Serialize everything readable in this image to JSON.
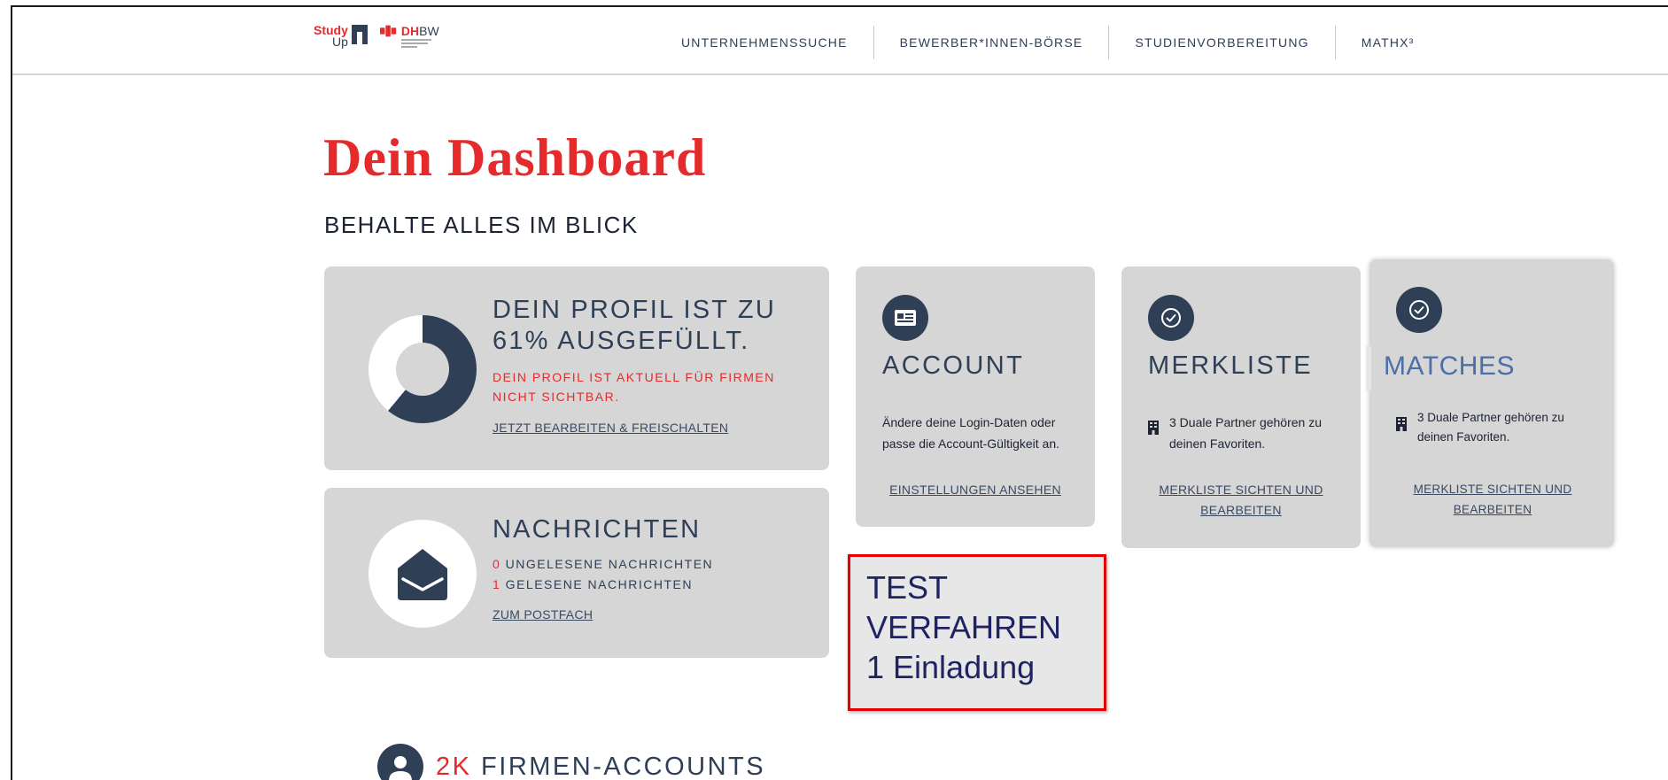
{
  "colors": {
    "accent_red": "#e42a2a",
    "navy": "#2e3f56",
    "card_bg": "#d6d6d6",
    "test_border": "#e40000",
    "test_text": "#1f2363",
    "match_title": "#4b6fa6"
  },
  "logo": {
    "study": "Study",
    "up": "Up",
    "dh": "DH",
    "bw": "BW"
  },
  "nav": [
    "UNTERNEHMENSSUCHE",
    "BEWERBER*INNEN-BÖRSE",
    "STUDIENVORBEREITUNG",
    "MATHX³"
  ],
  "page": {
    "title": "Dein Dashboard",
    "subtitle": "BEHALTE ALLES IM BLICK"
  },
  "profile": {
    "title_line1": "DEIN PROFIL IST ZU",
    "title_line2": "61% AUSGEFÜLLT.",
    "percent": 61,
    "status_line1": "DEIN PROFIL IST AKTUELL FÜR FIRMEN",
    "status_line2": "NICHT SICHTBAR.",
    "link": "JETZT BEARBEITEN & FREISCHALTEN"
  },
  "messages": {
    "title": "NACHRICHTEN",
    "unread_count": "0",
    "unread_label": " UNGELESENE NACHRICHTEN",
    "read_count": "1",
    "read_label": " GELESENE NACHRICHTEN",
    "link": "ZUM POSTFACH"
  },
  "account": {
    "icon": "id-card-icon",
    "title": "ACCOUNT",
    "body_line1": "Ändere deine Login-Daten oder",
    "body_line2": "passe die Account-Gültigkeit an.",
    "link": "EINSTELLUNGEN ANSEHEN"
  },
  "merkliste": {
    "icon": "check-circle-icon",
    "title": "MERKLISTE",
    "body_line1": "3 Duale Partner gehören zu",
    "body_line2": "deinen Favoriten.",
    "link_line1": "MERKLISTE SICHTEN UND",
    "link_line2": "BEARBEITEN"
  },
  "matches": {
    "icon": "check-circle-icon",
    "title": "MATCHES",
    "body_line1": "3 Duale Partner gehören zu",
    "body_line2": "deinen Favoriten.",
    "link_line1": "MERKLISTE SICHTEN UND",
    "link_line2": "BEARBEITEN"
  },
  "test": {
    "line1": "TEST",
    "line2": "VERFAHREN",
    "line3": "1 Einladung"
  },
  "firmen": {
    "count": "2K",
    "label": " FIRMEN-ACCOUNTS"
  }
}
